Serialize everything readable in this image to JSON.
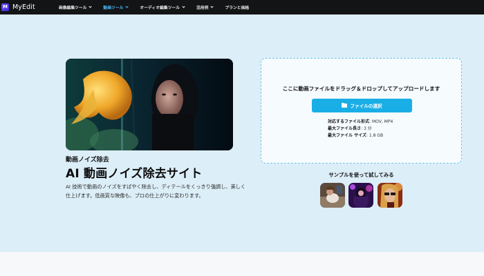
{
  "app": {
    "logo_mark": "M",
    "name": "MyEdit"
  },
  "nav": {
    "items": [
      {
        "label": "画像編集ツール",
        "active": false
      },
      {
        "label": "動画ツール",
        "active": true
      },
      {
        "label": "オーディオ編集ツール",
        "active": false
      },
      {
        "label": "活用例",
        "active": false
      },
      {
        "label": "プランと価格",
        "active": false
      }
    ],
    "active_color": "#4cc0ff"
  },
  "hero": {
    "subtitle": "動画ノイズ除去",
    "title": "AI 動画ノイズ除去サイト",
    "description": "AI 技術で動画のノイズをすばやく除去し、ディテールをくっきり強調し、美しく仕上げます。低画質な映像も、プロの仕上がりに変わります。"
  },
  "upload": {
    "prompt": "ここに動画ファイルをドラッグ＆ドロップしてアップロードします",
    "button_label": "ファイルの選択",
    "button_icon": "folder-icon",
    "formats_label": "対応するファイル形式",
    "formats_value": ": MOV, MP4",
    "length_label": "最大ファイル長さ",
    "length_value": ": 3 分",
    "size_label": "最大ファイル サイズ",
    "size_value": ": 1.8 GB"
  },
  "samples": {
    "title": "サンプルを使って試してみる"
  },
  "colors": {
    "topbar": "#131416",
    "hero_background": "#dceef8",
    "accent": "#1aaee6",
    "upload_border": "#6fc4e8"
  }
}
